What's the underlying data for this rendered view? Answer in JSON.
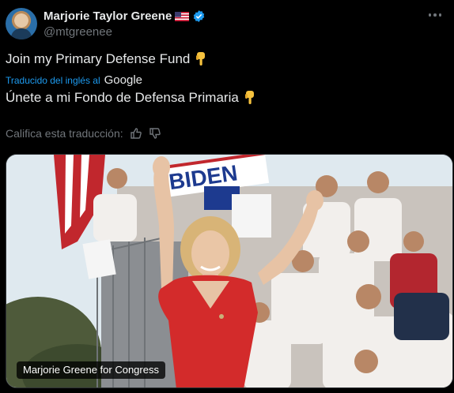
{
  "author": {
    "name": "Marjorie Taylor Greene",
    "handle": "@mtgreenee",
    "verified_icon": "verified-badge-icon",
    "flag_icon": "us-flag-icon"
  },
  "tweet": {
    "text": "Join my Primary Defense Fund",
    "emoji": "backhand-index-pointing-down"
  },
  "translation": {
    "label": "Traducido del inglés al",
    "provider": "Google",
    "text": "Únete a mi Fondo de Defensa Primaria"
  },
  "rating": {
    "label": "Califica esta traducción:"
  },
  "media": {
    "caption": "Marjorie Greene for Congress",
    "sign_text": "BIDEN"
  },
  "colors": {
    "background": "#000000",
    "text": "#e7e9ea",
    "secondary": "#71767b",
    "link": "#1d9bf0",
    "verified": "#1d9bf0"
  }
}
